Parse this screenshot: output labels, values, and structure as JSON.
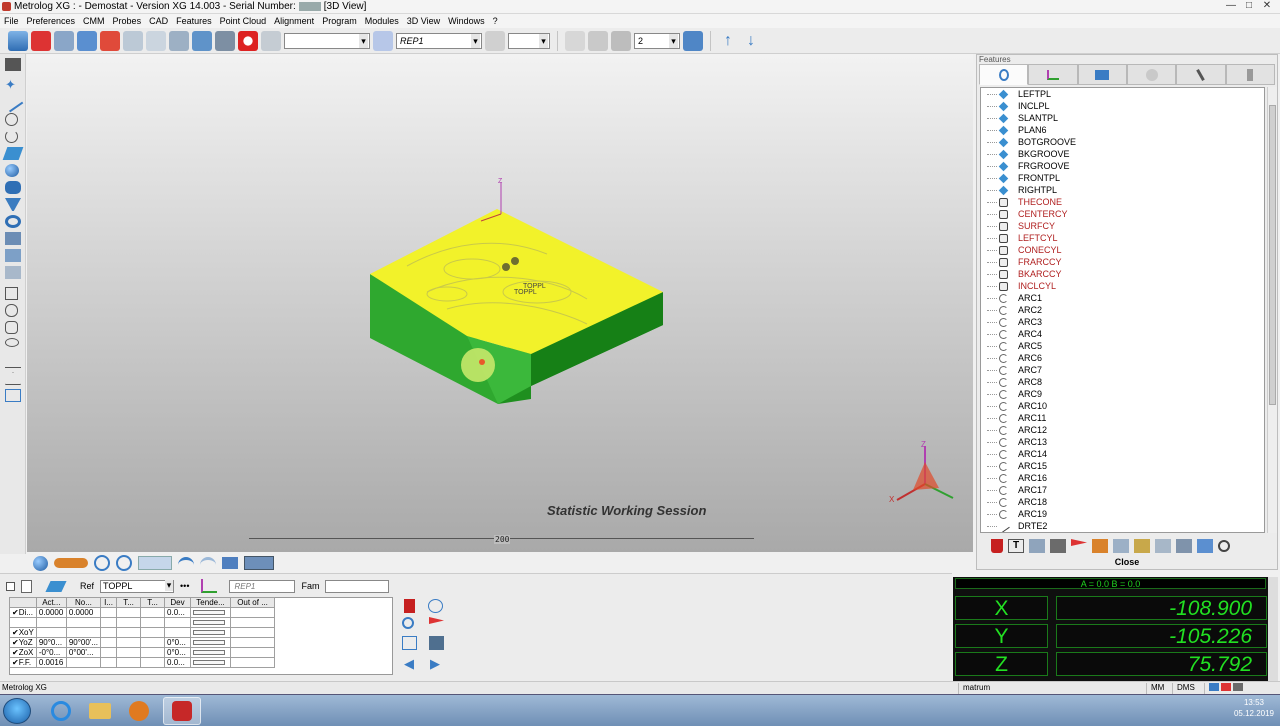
{
  "window": {
    "title_prefix": "Metrolog XG : - Demostat - Version XG 14.003 - Serial Number:",
    "title_suffix": "[3D View]",
    "buttons": {
      "minimize": "—",
      "maximize": "□",
      "close": "✕"
    }
  },
  "menu": [
    "File",
    "Preferences",
    "CMM",
    "Probes",
    "CAD",
    "Features",
    "Point Cloud",
    "Alignment",
    "Program",
    "Modules",
    "3D View",
    "Windows",
    "?"
  ],
  "toolbar": {
    "combo_empty": "",
    "rep_combo": "REP1",
    "number_combo": "2"
  },
  "view3d": {
    "session_label": "Statistic Working Session",
    "scale_label": "200",
    "feature_label_top": "TOPPL",
    "feature_label_under": "TOPPL",
    "triad_axis_z": "Z",
    "triad_axis_x": "X"
  },
  "features_panel": {
    "title": "Features",
    "close_label": "Close",
    "items": [
      {
        "label": "LEFTPL",
        "type": "plane",
        "red": false
      },
      {
        "label": "INCLPL",
        "type": "plane",
        "red": false
      },
      {
        "label": "SLANTPL",
        "type": "plane",
        "red": false
      },
      {
        "label": "PLAN6",
        "type": "plane",
        "red": false
      },
      {
        "label": "BOTGROOVE",
        "type": "plane",
        "red": false
      },
      {
        "label": "BKGROOVE",
        "type": "plane",
        "red": false
      },
      {
        "label": "FRGROOVE",
        "type": "plane",
        "red": false
      },
      {
        "label": "FRONTPL",
        "type": "plane",
        "red": false
      },
      {
        "label": "RIGHTPL",
        "type": "plane",
        "red": false
      },
      {
        "label": "THECONE",
        "type": "cyl",
        "red": true
      },
      {
        "label": "CENTERCY",
        "type": "cyl",
        "red": true
      },
      {
        "label": "SURFCY",
        "type": "cyl",
        "red": true
      },
      {
        "label": "LEFTCYL",
        "type": "cyl",
        "red": true
      },
      {
        "label": "CONECYL",
        "type": "cyl",
        "red": true
      },
      {
        "label": "FRARCCY",
        "type": "cyl",
        "red": true
      },
      {
        "label": "BKARCCY",
        "type": "cyl",
        "red": true
      },
      {
        "label": "INCLCYL",
        "type": "cyl",
        "red": true
      },
      {
        "label": "ARC1",
        "type": "arc",
        "red": false
      },
      {
        "label": "ARC2",
        "type": "arc",
        "red": false
      },
      {
        "label": "ARC3",
        "type": "arc",
        "red": false
      },
      {
        "label": "ARC4",
        "type": "arc",
        "red": false
      },
      {
        "label": "ARC5",
        "type": "arc",
        "red": false
      },
      {
        "label": "ARC6",
        "type": "arc",
        "red": false
      },
      {
        "label": "ARC7",
        "type": "arc",
        "red": false
      },
      {
        "label": "ARC8",
        "type": "arc",
        "red": false
      },
      {
        "label": "ARC9",
        "type": "arc",
        "red": false
      },
      {
        "label": "ARC10",
        "type": "arc",
        "red": false
      },
      {
        "label": "ARC11",
        "type": "arc",
        "red": false
      },
      {
        "label": "ARC12",
        "type": "arc",
        "red": false
      },
      {
        "label": "ARC13",
        "type": "arc",
        "red": false
      },
      {
        "label": "ARC14",
        "type": "arc",
        "red": false
      },
      {
        "label": "ARC15",
        "type": "arc",
        "red": false
      },
      {
        "label": "ARC16",
        "type": "arc",
        "red": false
      },
      {
        "label": "ARC17",
        "type": "arc",
        "red": false
      },
      {
        "label": "ARC18",
        "type": "arc",
        "red": false
      },
      {
        "label": "ARC19",
        "type": "arc",
        "red": false
      },
      {
        "label": "DRTE2",
        "type": "line",
        "red": false
      }
    ]
  },
  "results": {
    "ref_label": "Ref",
    "ref_value": "TOPPL",
    "rep_label": "REP1",
    "fam_label": "Fam",
    "headers": [
      "",
      "Act...",
      "No...",
      "I...",
      "T...",
      "T...",
      "Dev",
      "Tende...",
      "Out of ..."
    ],
    "rows": [
      {
        "check": "✔",
        "name": "Di...",
        "act": "0.0000",
        "nom": "0.0000",
        "dev": "0.0..."
      },
      {
        "check": "",
        "name": "",
        "act": "",
        "nom": "",
        "dev": ""
      },
      {
        "check": "✔",
        "name": "XoY",
        "act": "",
        "nom": "",
        "dev": ""
      },
      {
        "check": "✔",
        "name": "YoZ",
        "act": "90°0...",
        "nom": "90°00'...",
        "dev": "0°0..."
      },
      {
        "check": "✔",
        "name": "ZoX",
        "act": "-0°0...",
        "nom": "0°00'...",
        "dev": "0°0..."
      },
      {
        "check": "✔",
        "name": "F.F.",
        "act": "0.0016",
        "nom": "",
        "dev": "0.0..."
      }
    ]
  },
  "dro": {
    "title": "A = 0.0 B = 0.0",
    "axes": [
      {
        "axis": "X",
        "value": "-108.900"
      },
      {
        "axis": "Y",
        "value": "-105.226"
      },
      {
        "axis": "Z",
        "value": "75.792"
      }
    ],
    "color": "#22e022"
  },
  "statusbar": {
    "app": "Metrolog XG",
    "user": "matrum",
    "units": "MM",
    "angle": "DMS"
  },
  "taskbar": {
    "time": "13:53",
    "date": "05.12.2019"
  }
}
